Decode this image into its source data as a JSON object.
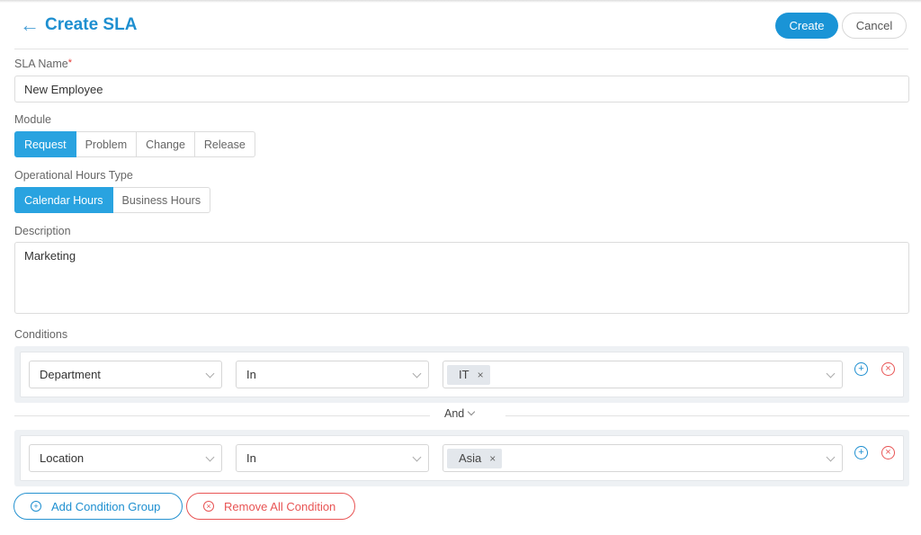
{
  "header": {
    "back_icon": "←",
    "title": "Create SLA",
    "create_label": "Create",
    "cancel_label": "Cancel"
  },
  "form": {
    "sla_name_label": "SLA Name",
    "required_mark": "*",
    "sla_name_value": "New Employee",
    "module_label": "Module",
    "modules": [
      {
        "label": "Request",
        "active": true
      },
      {
        "label": "Problem",
        "active": false
      },
      {
        "label": "Change",
        "active": false
      },
      {
        "label": "Release",
        "active": false
      }
    ],
    "hours_type_label": "Operational Hours Type",
    "hours_types": [
      {
        "label": "Calendar Hours",
        "active": true
      },
      {
        "label": "Business Hours",
        "active": false
      }
    ],
    "description_label": "Description",
    "description_value": "Marketing",
    "conditions_label": "Conditions"
  },
  "conditions": {
    "groups": [
      {
        "field": "Department",
        "operator": "In",
        "values": [
          "IT"
        ]
      },
      {
        "field": "Location",
        "operator": "In",
        "values": [
          "Asia"
        ]
      }
    ],
    "joiner": "And",
    "tag_remove_glyph": "×",
    "add_icon": "+",
    "remove_icon": "×"
  },
  "footer": {
    "add_group_label": "Add Condition Group",
    "remove_all_label": "Remove All Condition",
    "add_group_icon": "+",
    "remove_all_icon": "×"
  },
  "colors": {
    "accent": "#1a94d6",
    "active_segment": "#29a3e0",
    "danger": "#e85454"
  }
}
